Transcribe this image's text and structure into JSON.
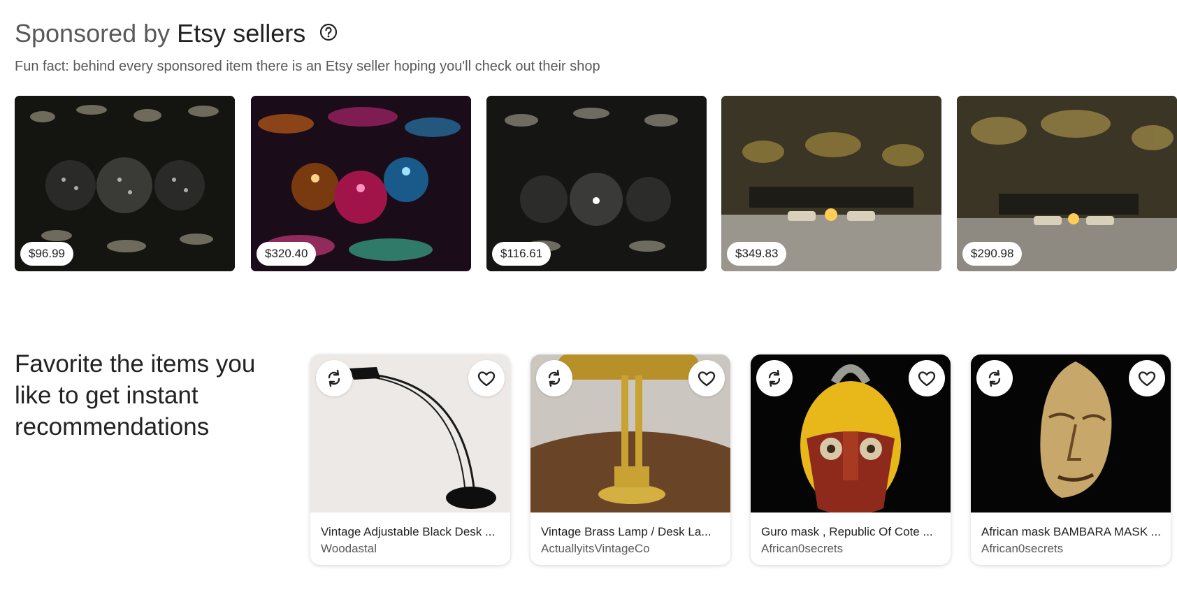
{
  "sponsored": {
    "title_light": "Sponsored by",
    "title_bold": "Etsy sellers",
    "help_icon": "question-circle-icon",
    "subtitle": "Fun fact: behind every sponsored item there is an Etsy seller hoping you'll check out their shop",
    "items": [
      {
        "price": "$96.99"
      },
      {
        "price": "$320.40"
      },
      {
        "price": "$116.61"
      },
      {
        "price": "$349.83"
      },
      {
        "price": "$290.98"
      }
    ]
  },
  "favorites": {
    "heading": "Favorite the items you like to get instant recommendations",
    "refresh_icon": "refresh-icon",
    "heart_icon": "heart-icon",
    "items": [
      {
        "name": "Vintage Adjustable Black Desk ...",
        "shop": "Woodastal"
      },
      {
        "name": "Vintage Brass Lamp / Desk La...",
        "shop": "ActuallyitsVintageCo"
      },
      {
        "name": "Guro mask , Republic Of Cote ...",
        "shop": "African0secrets"
      },
      {
        "name": "African mask BAMBARA MASK ...",
        "shop": "African0secrets"
      }
    ]
  }
}
